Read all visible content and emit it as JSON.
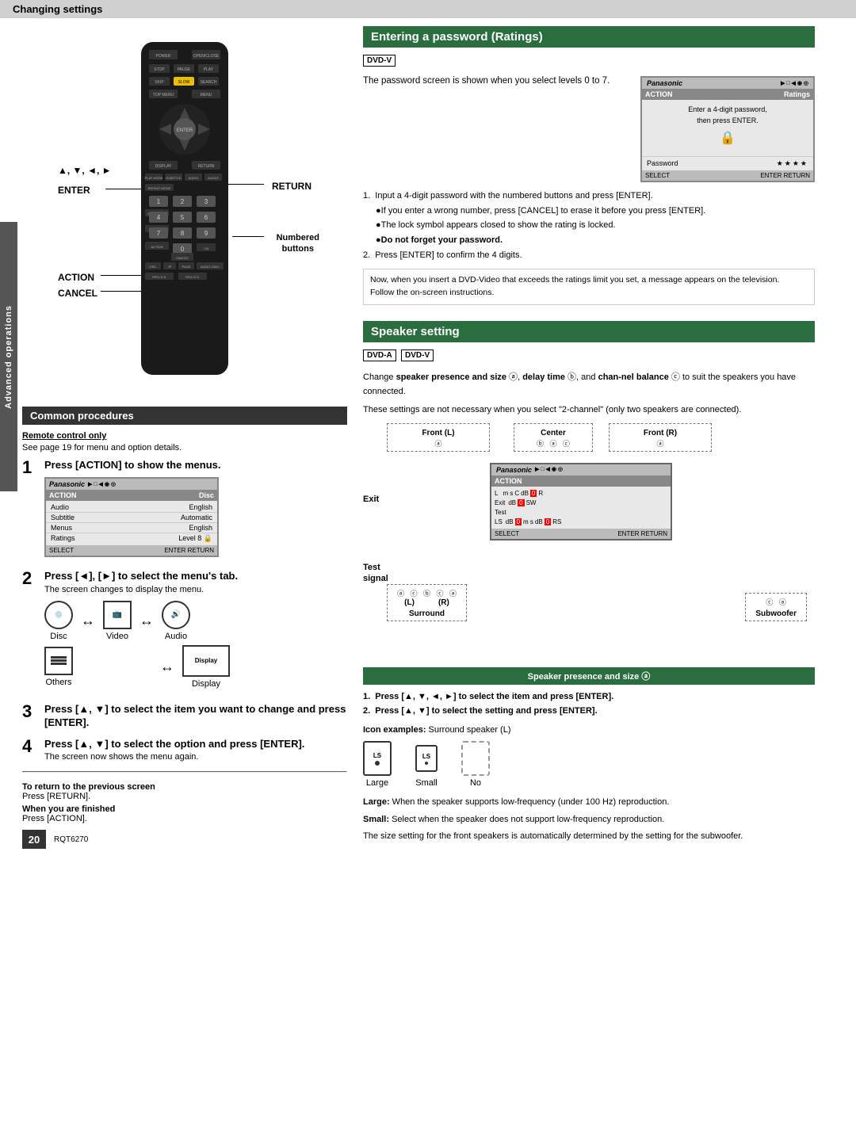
{
  "header": {
    "title": "Changing settings"
  },
  "side_tab": {
    "label": "Advanced operations"
  },
  "left": {
    "remote_labels": {
      "enter": "ENTER",
      "return": "RETURN",
      "action": "ACTION",
      "cancel": "CANCEL",
      "numbered_buttons": "Numbered\nbuttons",
      "arrows": "▲, ▼, ◄, ►"
    },
    "common_procedures": {
      "header": "Common procedures",
      "remote_only_label": "Remote control only",
      "remote_only_text": "See page 19 for menu and option details.",
      "step1_num": "1",
      "step1_text": "Press [ACTION] to show the menus.",
      "step2_num": "2",
      "step2_text": "Press [◄], [►] to select the menu's tab.",
      "step2_sub": "The screen changes to display the menu.",
      "step3_num": "3",
      "step3_text": "Press [▲, ▼] to select the item you want to change and press [ENTER].",
      "step4_num": "4",
      "step4_text": "Press [▲, ▼] to select the option and press [ENTER].",
      "step4_sub": "The screen now shows the menu again.",
      "nav_items": [
        "Disc",
        "Video",
        "Audio",
        "Others",
        "Display"
      ],
      "screen_header_left": "ACTION",
      "screen_header_right": "Disc",
      "screen_rows": [
        {
          "label": "Audio",
          "value": "English"
        },
        {
          "label": "Subtitle",
          "value": "Automatic"
        },
        {
          "label": "Menus",
          "value": "English"
        },
        {
          "label": "Ratings",
          "value": "Level 8 🔒"
        }
      ]
    },
    "footer": {
      "to_return_label": "To return to the previous screen",
      "to_return_text": "Press [RETURN].",
      "when_finished_label": "When you are finished",
      "when_finished_text": "Press [ACTION].",
      "model_num": "RQT6270"
    },
    "page_num": "20"
  },
  "right": {
    "password": {
      "header": "Entering a password (Ratings)",
      "dvd_badge": "DVD-V",
      "intro": "The password screen is shown when you select levels 0 to 7.",
      "screen": {
        "logo": "Panasonic",
        "action_label": "ACTION",
        "ratings_label": "Ratings",
        "instruction": "Enter a 4-digit password,\nthen press ENTER.",
        "password_label": "Password",
        "password_value": "★★★★"
      },
      "steps": [
        "Input a 4-digit password with the numbered buttons and press [ENTER].",
        "●If you enter a wrong number, press [CANCEL] to erase it before you press [ENTER].",
        "●The lock symbol appears closed to show the rating is locked.",
        "●Do not forget your password.",
        "Press [ENTER] to confirm the 4 digits."
      ],
      "note": "Now, when you insert a DVD-Video that exceeds the ratings limit you set, a message appears on the television.\nFollow the on-screen instructions."
    },
    "speaker": {
      "header": "Speaker setting",
      "dvd_a_badge": "DVD-A",
      "dvd_v_badge": "DVD-V",
      "intro": "Change speaker presence and size ⓐ, delay time ⓑ, and channel balance ⓒ to suit the speakers you have connected.",
      "note2": "These settings are not necessary when you select \"2-channel\" (only two speakers are connected).",
      "diagram": {
        "front_l": "Front (L)",
        "center": "Center",
        "front_r": "Front (R)",
        "surround": "Surround",
        "subwoofer": "Subwoofer",
        "exit_label": "Exit",
        "test_label": "Test\nsignal",
        "l_label": "(L)",
        "r_label": "(R)",
        "circle_a": "ⓐ",
        "circle_b": "ⓑ",
        "circle_c": "ⓒ"
      },
      "presence_bar": "Speaker presence and size ⓐ",
      "press_steps": [
        "Press [▲, ▼, ◄, ►] to select the item and press [ENTER].",
        "Press [▲, ▼] to select the setting and press [ENTER]."
      ],
      "icon_examples_label": "Icon examples:",
      "icon_examples_sub": "Surround speaker (L)",
      "icons": [
        {
          "label": "Large",
          "type": "large"
        },
        {
          "label": "Small",
          "type": "small"
        },
        {
          "label": "No",
          "type": "no"
        }
      ],
      "large_desc": "Large: When the speaker supports low-frequency (under 100 Hz) reproduction.",
      "small_desc": "Small: Select when the speaker does not support low-frequency reproduction.",
      "auto_desc": "The size setting for the front speakers is automatically determined by the setting for the subwoofer."
    }
  }
}
